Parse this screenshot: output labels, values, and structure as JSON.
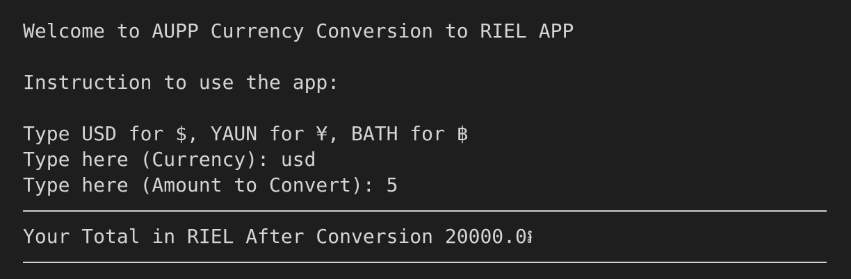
{
  "terminal": {
    "welcome": "Welcome to AUPP Currency Conversion to RIEL APP",
    "instruction_heading": "Instruction to use the app:",
    "currency_hint": "Type USD for $, YAUN for ¥, BATH for ฿",
    "currency_prompt": "Type here (Currency): usd",
    "amount_prompt": "Type here (Amount to Convert): 5",
    "separator": "--------------------------------------------------------------------",
    "result": "Your Total in RIEL After Conversion 20000.0៛"
  },
  "colors": {
    "background": "#1e1e1e",
    "text": "#d4d4d4"
  }
}
